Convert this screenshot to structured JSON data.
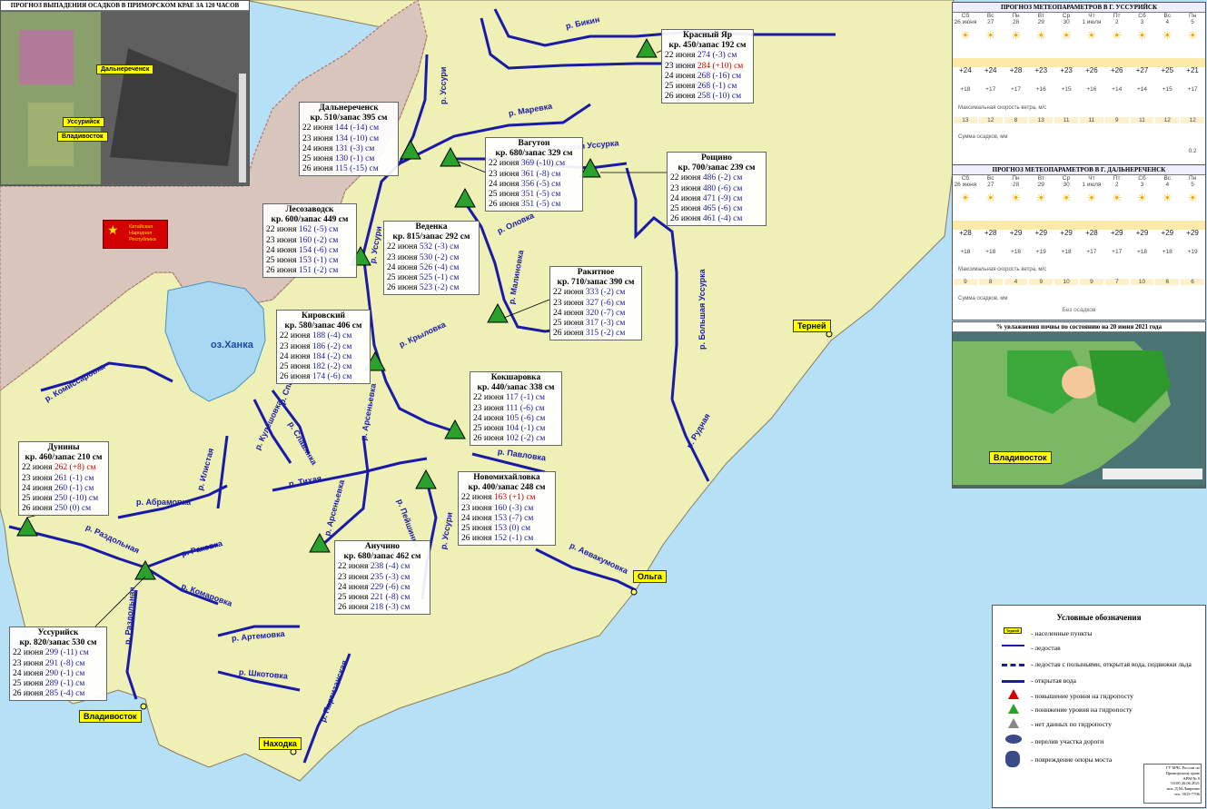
{
  "colors": {
    "sea": "#b5e0f5",
    "land": "#eef0b6",
    "river": "#1a1aa8",
    "triangle_down": "#2aa12a",
    "triangle_up": "#d40000",
    "china": "#c8a8a8"
  },
  "precip_map": {
    "title": "ПРОГНОЗ ВЫПАДЕНИЯ ОСАДКОВ В ПРИМОРСКОМ КРАЕ ЗА 120 ЧАСОВ",
    "towns": [
      "Дальнереченск",
      "Уссурийск",
      "Владивосток"
    ]
  },
  "china_badge": {
    "text": "Китайская Народная Республика"
  },
  "lake": "оз.Ханка",
  "rivers": [
    "р. Бикин",
    "р. Уссури",
    "р. Маревка",
    "р. Большая Уссурка",
    "р. Оловка",
    "р. Малиновка",
    "р. Большая Уссурка",
    "р. Крыловка",
    "р. Рудная",
    "р. Комиссаровка",
    "р. Илистая",
    "р. Абрамовка",
    "р. Тихая",
    "р. Спасовка",
    "р. Кулешовка",
    "р. Славянка",
    "р. Арсеньевка",
    "р. Павловка",
    "р. Раздольная",
    "р. Раковка",
    "р. Комаровка",
    "р. Артемовка",
    "р. Шкотовка",
    "р. Партизанская",
    "р. Аввакумовка",
    "р. Уссури",
    "р. Арсеньевка",
    "р. Пейшинка",
    "р. Уссури",
    "р. Раздольная"
  ],
  "gauges": [
    {
      "name": "Красный Яр",
      "kr": "кр. 450/запас 192 см",
      "rows": [
        [
          "22 июня",
          "274 (-3) см",
          false
        ],
        [
          "23 июня",
          "284 (+10) см",
          true
        ],
        [
          "24 июня",
          "268 (-16) см",
          false
        ],
        [
          "25 июня",
          "268 (-1) см",
          false
        ],
        [
          "26 июня",
          "258 (-10) см",
          false
        ]
      ]
    },
    {
      "name": "Дальнереченск",
      "kr": "кр. 510/запас 395 см",
      "rows": [
        [
          "22 июня",
          "144 (-14) см",
          false
        ],
        [
          "23 июня",
          "134 (-10) см",
          false
        ],
        [
          "24 июня",
          "131 (-3) см",
          false
        ],
        [
          "25 июня",
          "130 (-1) см",
          false
        ],
        [
          "26 июня",
          "115 (-15) см",
          false
        ]
      ]
    },
    {
      "name": "Вагутон",
      "kr": "кр. 680/запас 329 см",
      "rows": [
        [
          "22 июня",
          "369 (-10) см",
          false
        ],
        [
          "23 июня",
          "361 (-8) см",
          false
        ],
        [
          "24 июня",
          "356 (-5) см",
          false
        ],
        [
          "25 июня",
          "351 (-5) см",
          false
        ],
        [
          "26 июня",
          "351 (-5) см",
          false
        ]
      ]
    },
    {
      "name": "Рощино",
      "kr": "кр. 700/запас 239 см",
      "rows": [
        [
          "22 июня",
          "486 (-2) см",
          false
        ],
        [
          "23 июня",
          "480 (-6) см",
          false
        ],
        [
          "24 июня",
          "471 (-9) см",
          false
        ],
        [
          "25 июня",
          "465 (-6) см",
          false
        ],
        [
          "26 июня",
          "461 (-4) см",
          false
        ]
      ]
    },
    {
      "name": "Лесозаводск",
      "kr": "кр. 600/запас 449 см",
      "rows": [
        [
          "22 июня",
          "162 (-5) см",
          false
        ],
        [
          "23 июня",
          "160 (-2) см",
          false
        ],
        [
          "24 июня",
          "154 (-6) см",
          false
        ],
        [
          "25 июня",
          "153 (-1) см",
          false
        ],
        [
          "26 июня",
          "151 (-2) см",
          false
        ]
      ]
    },
    {
      "name": "Веденка",
      "kr": "кр. 815/запас 292 см",
      "rows": [
        [
          "22 июня",
          "532 (-3) см",
          false
        ],
        [
          "23 июня",
          "530 (-2) см",
          false
        ],
        [
          "24 июня",
          "526 (-4) см",
          false
        ],
        [
          "25 июня",
          "525 (-1) см",
          false
        ],
        [
          "26 июня",
          "523 (-2) см",
          false
        ]
      ]
    },
    {
      "name": "Ракитное",
      "kr": "кр. 710/запас 390 см",
      "rows": [
        [
          "22 июня",
          "333 (-2) см",
          false
        ],
        [
          "23 июня",
          "327 (-6) см",
          false
        ],
        [
          "24 июня",
          "320 (-7) см",
          false
        ],
        [
          "25 июня",
          "317 (-3) см",
          false
        ],
        [
          "26 июня",
          "315 (-2) см",
          false
        ]
      ]
    },
    {
      "name": "Кировский",
      "kr": "кр. 580/запас 406 см",
      "rows": [
        [
          "22 июня",
          "188 (-4) см",
          false
        ],
        [
          "23 июня",
          "186 (-2) см",
          false
        ],
        [
          "24 июня",
          "184 (-2) см",
          false
        ],
        [
          "25 июня",
          "182 (-2) см",
          false
        ],
        [
          "26 июня",
          "174 (-6) см",
          false
        ]
      ]
    },
    {
      "name": "Кокшаровка",
      "kr": "кр. 440/запас 338 см",
      "rows": [
        [
          "22 июня",
          "117 (-1) см",
          false
        ],
        [
          "23 июня",
          "111 (-6) см",
          false
        ],
        [
          "24 июня",
          "105 (-6) см",
          false
        ],
        [
          "25 июня",
          "104 (-1) см",
          false
        ],
        [
          "26 июня",
          "102 (-2) см",
          false
        ]
      ]
    },
    {
      "name": "Дунины",
      "kr": "кр. 460/запас 210 см",
      "rows": [
        [
          "22 июня",
          "262 (+8) см",
          true
        ],
        [
          "23 июня",
          "261 (-1) см",
          false
        ],
        [
          "24 июня",
          "260 (-1) см",
          false
        ],
        [
          "25 июня",
          "250 (-10) см",
          false
        ],
        [
          "26 июня",
          "250 (0) см",
          false
        ]
      ]
    },
    {
      "name": "Новомихайловка",
      "kr": "кр. 400/запас 248 см",
      "rows": [
        [
          "22 июня",
          "163 (+1) см",
          true
        ],
        [
          "23 июня",
          "160 (-3) см",
          false
        ],
        [
          "24 июня",
          "153 (-7) см",
          false
        ],
        [
          "25 июня",
          "153 (0) см",
          false
        ],
        [
          "26 июня",
          "152 (-1) см",
          false
        ]
      ]
    },
    {
      "name": "Анучино",
      "kr": "кр. 680/запас 462 см",
      "rows": [
        [
          "22 июня",
          "238 (-4) см",
          false
        ],
        [
          "23 июня",
          "235 (-3) см",
          false
        ],
        [
          "24 июня",
          "229 (-6) см",
          false
        ],
        [
          "25 июня",
          "221 (-8) см",
          false
        ],
        [
          "26 июня",
          "218 (-3) см",
          false
        ]
      ]
    },
    {
      "name": "Уссурийск",
      "kr": "кр. 820/запас 530 см",
      "rows": [
        [
          "22 июня",
          "299 (-11) см",
          false
        ],
        [
          "23 июня",
          "291 (-8) см",
          false
        ],
        [
          "24 июня",
          "290 (-1) см",
          false
        ],
        [
          "25 июня",
          "289 (-1) см",
          false
        ],
        [
          "26 июня",
          "285 (-4) см",
          false
        ]
      ]
    }
  ],
  "towns": [
    "Терней",
    "Ольга",
    "Находка",
    "Владивосток"
  ],
  "forecast_ussuriysk": {
    "title": "ПРОГНОЗ МЕТЕОПАРАМЕТРОВ В Г. УССУРИЙСК",
    "days": [
      "Сб",
      "Вс",
      "Пн",
      "Вт",
      "Ср",
      "Чт",
      "Пт",
      "Сб",
      "Вс",
      "Пн"
    ],
    "dates": [
      "26 июня",
      "27",
      "28",
      "29",
      "30",
      "1 июля",
      "2",
      "3",
      "4",
      "5"
    ],
    "tmax": [
      "+24",
      "+24",
      "+28",
      "+23",
      "+23",
      "+26",
      "+26",
      "+27",
      "+25",
      "+21"
    ],
    "tmin": [
      "+18",
      "+17",
      "+17",
      "+16",
      "+15",
      "+16",
      "+14",
      "+14",
      "+15",
      "+17"
    ],
    "wind_label": "Максимальная скорость ветра, м/с",
    "wind": [
      "13",
      "12",
      "8",
      "13",
      "11",
      "11",
      "9",
      "11",
      "12",
      "12"
    ],
    "precip_label": "Сумма осадков, мм",
    "precip": [
      "",
      "",
      "",
      "",
      "",
      "",
      "",
      "",
      "",
      "0.2"
    ]
  },
  "forecast_dalnerechensk": {
    "title": "ПРОГНОЗ МЕТЕОПАРАМЕТРОВ В Г. ДАЛЬНЕРЕЧЕНСК",
    "days": [
      "Сб",
      "Вс",
      "Пн",
      "Вт",
      "Ср",
      "Чт",
      "Пт",
      "Сб",
      "Вс",
      "Пн"
    ],
    "dates": [
      "26 июня",
      "27",
      "28",
      "29",
      "30",
      "1 июля",
      "2",
      "3",
      "4",
      "5"
    ],
    "tmax": [
      "+28",
      "+28",
      "+29",
      "+29",
      "+29",
      "+28",
      "+29",
      "+29",
      "+29",
      "+29"
    ],
    "tmin": [
      "+18",
      "+18",
      "+18",
      "+19",
      "+18",
      "+17",
      "+17",
      "+18",
      "+18",
      "+19"
    ],
    "wind_label": "Максимальная скорость ветра, м/с",
    "wind": [
      "9",
      "8",
      "4",
      "9",
      "10",
      "9",
      "7",
      "10",
      "6",
      "6"
    ],
    "precip_label": "Сумма осадков, мм",
    "precip_note": "Без осадков"
  },
  "soil_panel": {
    "title": "% увлажнения почвы по состоянию на 20 июня 2021 года",
    "town": "Владивосток"
  },
  "legend": {
    "title": "Условные обозначения",
    "items": [
      "- населенные пункты",
      "- ледостав",
      "- ледостав с полыньями, открытая вода, подвижки льда",
      "- открытая вода",
      "- повышение уровня на гидропосту",
      "- понижение уровня на гидропосту",
      "- нет данных по гидропосту",
      "- перелив участка дороги",
      "- повреждение опоры моста"
    ],
    "town_sample": "Терней"
  },
  "footer": {
    "lines": [
      "ГУ МЧС России по",
      "Приморскому краю",
      "АРМ № 9",
      "03:00 26.06.2021",
      "исп. Д.М.Лавренко",
      "тел. 5015-7706"
    ]
  }
}
